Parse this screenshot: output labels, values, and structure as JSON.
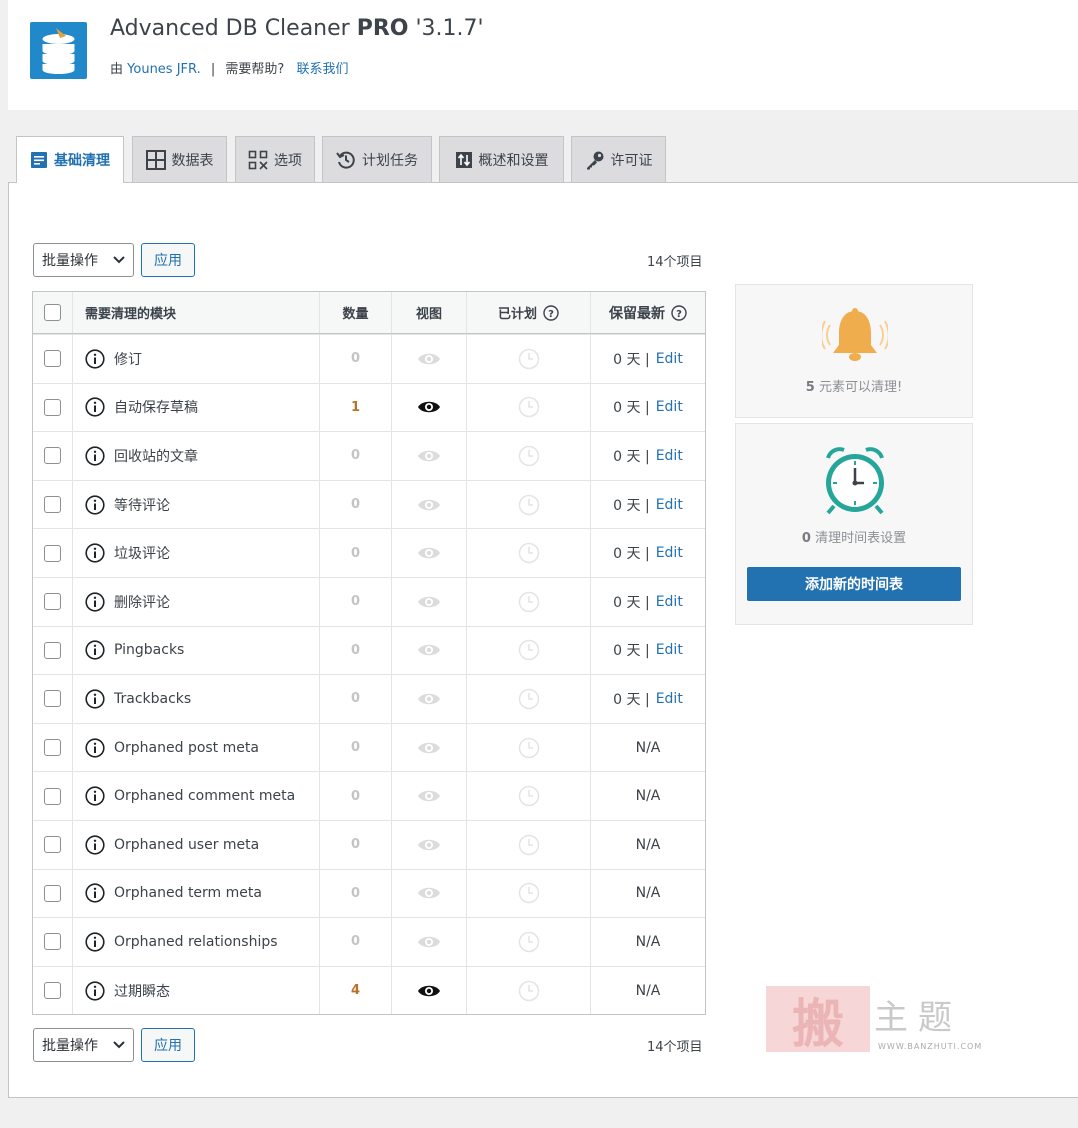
{
  "plugin": {
    "name": "Advanced DB Cleaner",
    "edition": "PRO",
    "version": "'3.1.7'",
    "by_label": "由",
    "author": "Younes JFR.",
    "help_label": "需要帮助?",
    "contact_label": "联系我们"
  },
  "tabs": [
    {
      "label": "基础清理",
      "icon": "list-icon",
      "active": true
    },
    {
      "label": "数据表",
      "icon": "grid-icon"
    },
    {
      "label": "选项",
      "icon": "options-icon"
    },
    {
      "label": "计划任务",
      "icon": "history-icon"
    },
    {
      "label": "概述和设置",
      "icon": "sort-icon"
    },
    {
      "label": "许可证",
      "icon": "key-icon"
    }
  ],
  "bulk": {
    "select_label": "批量操作",
    "apply_label": "应用",
    "items_count": "14个项目"
  },
  "table": {
    "headers": {
      "name": "需要清理的模块",
      "count": "数量",
      "view": "视图",
      "scheduled": "已计划",
      "keep_last": "保留最新"
    },
    "edit_label": "Edit",
    "rows": [
      {
        "name": "修订",
        "count": "0",
        "keep": "0 天 |",
        "editable": true,
        "viewable": false
      },
      {
        "name": "自动保存草稿",
        "count": "1",
        "keep": "0 天 |",
        "editable": true,
        "viewable": true
      },
      {
        "name": "回收站的文章",
        "count": "0",
        "keep": "0 天 |",
        "editable": true,
        "viewable": false
      },
      {
        "name": "等待评论",
        "count": "0",
        "keep": "0 天 |",
        "editable": true,
        "viewable": false
      },
      {
        "name": "垃圾评论",
        "count": "0",
        "keep": "0 天 |",
        "editable": true,
        "viewable": false
      },
      {
        "name": "删除评论",
        "count": "0",
        "keep": "0 天 |",
        "editable": true,
        "viewable": false
      },
      {
        "name": "Pingbacks",
        "count": "0",
        "keep": "0 天 |",
        "editable": true,
        "viewable": false
      },
      {
        "name": "Trackbacks",
        "count": "0",
        "keep": "0 天 |",
        "editable": true,
        "viewable": false
      },
      {
        "name": "Orphaned post meta",
        "count": "0",
        "keep": "N/A",
        "editable": false,
        "viewable": false
      },
      {
        "name": "Orphaned comment meta",
        "count": "0",
        "keep": "N/A",
        "editable": false,
        "viewable": false
      },
      {
        "name": "Orphaned user meta",
        "count": "0",
        "keep": "N/A",
        "editable": false,
        "viewable": false
      },
      {
        "name": "Orphaned term meta",
        "count": "0",
        "keep": "N/A",
        "editable": false,
        "viewable": false
      },
      {
        "name": "Orphaned relationships",
        "count": "0",
        "keep": "N/A",
        "editable": false,
        "viewable": false
      },
      {
        "name": "过期瞬态",
        "count": "4",
        "keep": "N/A",
        "editable": false,
        "viewable": true
      }
    ]
  },
  "sidebar": {
    "cleanable_count": "5",
    "cleanable_text": "元素可以清理!",
    "schedule_count": "0",
    "schedule_text": "清理时间表设置",
    "add_schedule_label": "添加新的时间表"
  },
  "watermark": {
    "seal": "搬",
    "text": "主题",
    "url": "WWW.BANZHUTI.COM"
  },
  "colors": {
    "accent": "#2271b1",
    "count_highlight": "#b9722b",
    "bell": "#f0ad4e",
    "clock": "#26a69a"
  }
}
